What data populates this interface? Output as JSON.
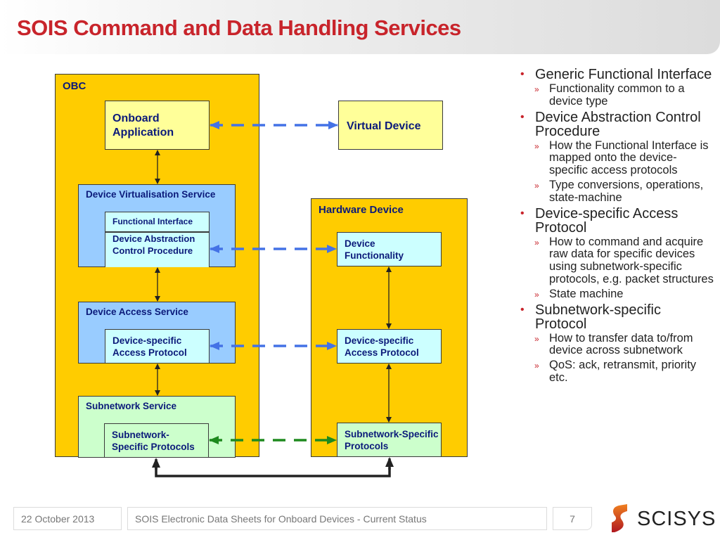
{
  "title": "SOIS Command and Data Handling Services",
  "diagram": {
    "obc": {
      "label": "OBC",
      "onboard_application": "Onboard Application",
      "dvs": {
        "label": "Device Virtualisation Service",
        "functional_interface": "Functional Interface",
        "dacp": "Device Abstraction Control Procedure"
      },
      "das": {
        "label": "Device Access Service",
        "protocol": "Device-specific Access Protocol"
      },
      "subnetwork": {
        "label": "Subnetwork Service",
        "protocols": "Subnetwork-Specific Protocols"
      }
    },
    "virtual_device": "Virtual Device",
    "hardware_device": {
      "label": "Hardware Device",
      "functionality": "Device Functionality",
      "protocol": "Device-specific Access Protocol",
      "subnetwork_protocols": "Subnetwork-Specific Protocols"
    },
    "colors": {
      "obc_fill": "#ffcc00",
      "application_fill": "#ffff99",
      "service_fill": "#99ccff",
      "inner_fill": "#ccffff",
      "subnetwork_fill": "#ccffcc",
      "blue_link": "#4472e6",
      "green_link": "#1e8a1e"
    }
  },
  "bullets": [
    {
      "text": "Generic Functional Interface",
      "sub": [
        "Functionality common to a device type"
      ]
    },
    {
      "text": "Device Abstraction Control Procedure",
      "sub": [
        "How the Functional Interface is mapped onto the device-specific access protocols",
        "Type conversions, operations, state-machine"
      ]
    },
    {
      "text": "Device-specific Access Protocol",
      "sub": [
        "How to command and acquire raw data for specific devices using subnetwork-specific protocols, e.g. packet structures",
        "State machine"
      ]
    },
    {
      "text": "Subnetwork-specific Protocol",
      "sub": [
        "How to transfer data to/from device across subnetwork",
        "QoS: ack, retransmit, priority etc."
      ]
    }
  ],
  "footer": {
    "date": "22 October 2013",
    "presentation": "SOIS Electronic Data Sheets for Onboard Devices - Current Status",
    "page": "7",
    "logo": "SCISYS"
  }
}
